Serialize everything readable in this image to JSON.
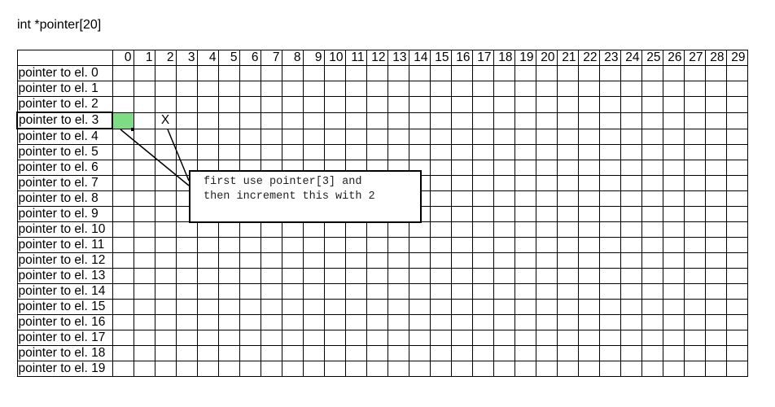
{
  "title": "int *pointer[20]",
  "columns": [
    "0",
    "1",
    "2",
    "3",
    "4",
    "5",
    "6",
    "7",
    "8",
    "9",
    "10",
    "11",
    "12",
    "13",
    "14",
    "15",
    "16",
    "17",
    "18",
    "19",
    "20",
    "21",
    "22",
    "23",
    "24",
    "25",
    "26",
    "27",
    "28",
    "29"
  ],
  "rows": [
    "pointer to el. 0",
    "pointer to el. 1",
    "pointer to el. 2",
    "pointer to el. 3",
    "pointer to el. 4",
    "pointer to el. 5",
    "pointer to el. 6",
    "pointer to el. 7",
    "pointer to el. 8",
    "pointer to el. 9",
    "pointer to el. 10",
    "pointer to el. 11",
    "pointer to el. 12",
    "pointer to el. 13",
    "pointer to el. 14",
    "pointer to el. 15",
    "pointer to el. 16",
    "pointer to el. 17",
    "pointer to el. 18",
    "pointer to el. 19"
  ],
  "highlight": {
    "row": 3,
    "col": 0,
    "color": "#7edd84"
  },
  "mark": {
    "row": 3,
    "col": 2,
    "text": "X"
  },
  "callout": {
    "lines": [
      "first use pointer[3] and",
      "then increment this with 2"
    ]
  }
}
